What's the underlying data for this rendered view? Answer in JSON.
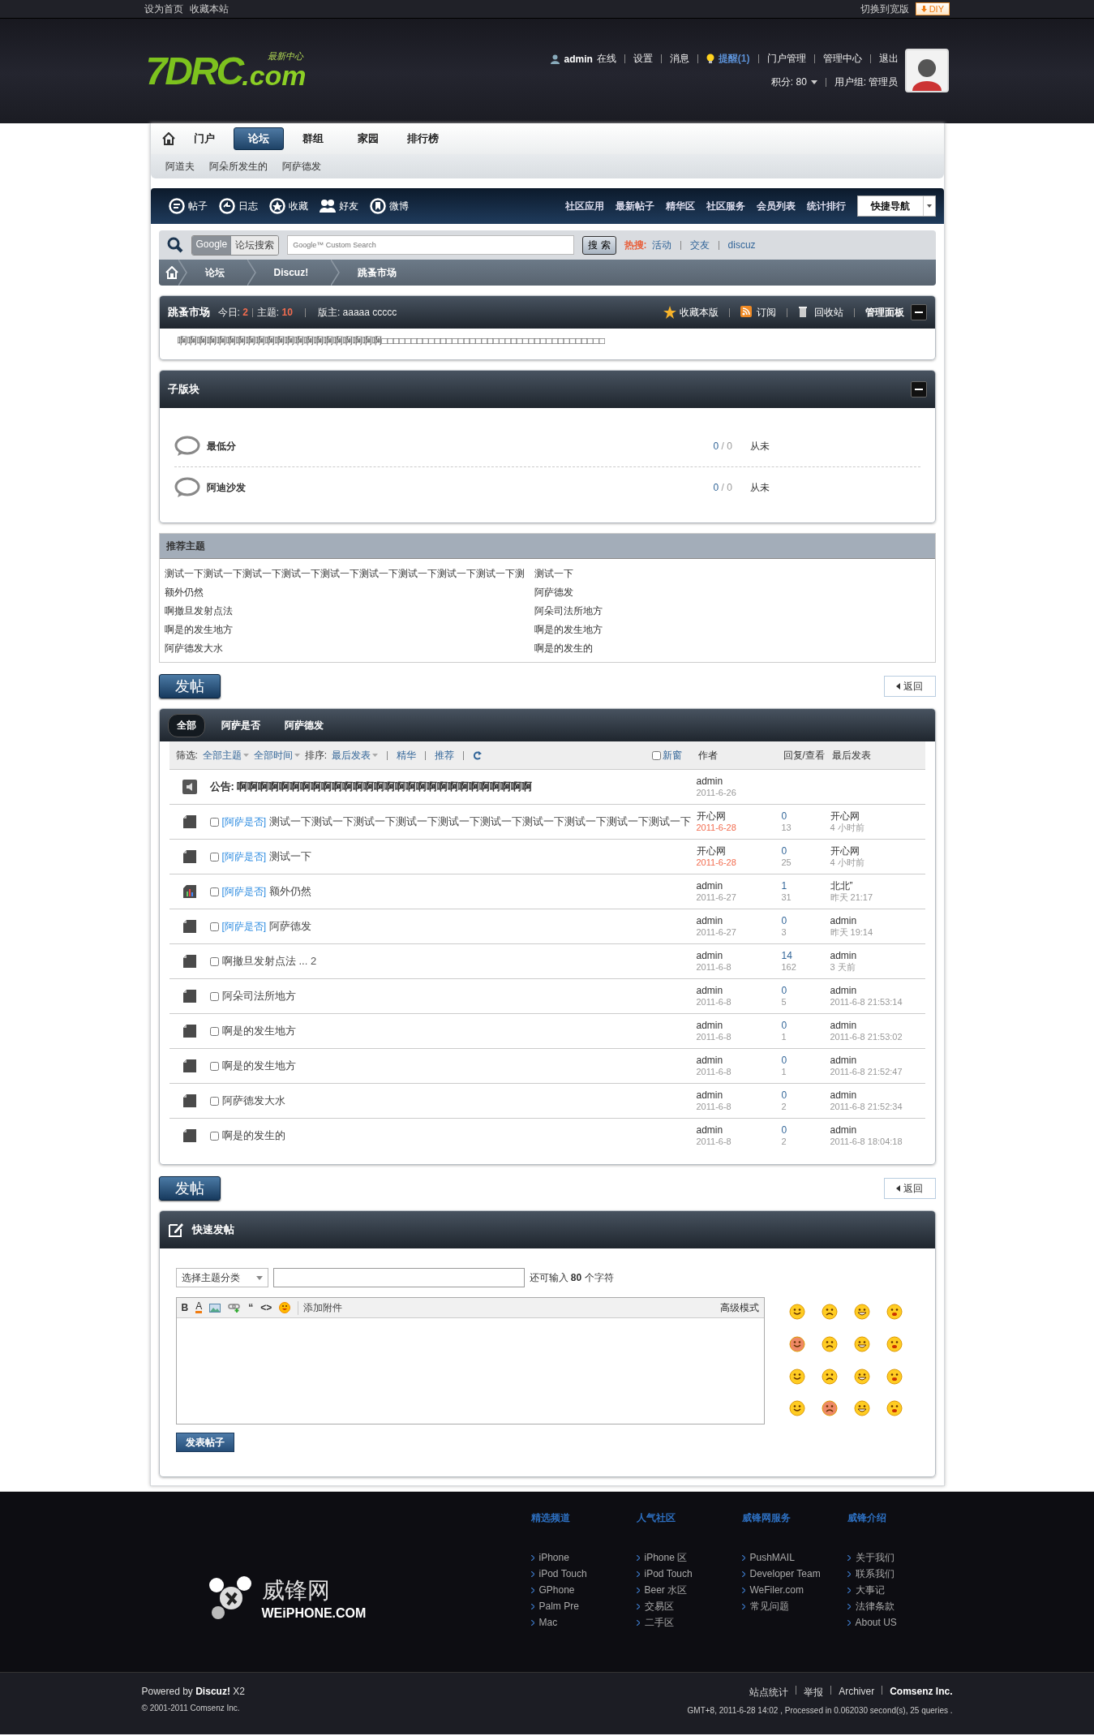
{
  "topbar": {
    "links": [
      "设为首页",
      "收藏本站"
    ],
    "switch": "切换到宽版",
    "diy": "DIY"
  },
  "header": {
    "logo": {
      "main": "7DRC",
      "suffix": ".com",
      "tagline": "最新中心"
    },
    "user": {
      "name": "admin",
      "status": "在线",
      "links": [
        "设置",
        "消息"
      ],
      "reminder": "提醒(1)",
      "links2": [
        "门户管理",
        "管理中心",
        "退出"
      ],
      "credits": "积分: 80",
      "group": "用户组: 管理员"
    }
  },
  "nav": {
    "items": [
      {
        "label": "门户",
        "selected": false
      },
      {
        "label": "论坛",
        "selected": true
      },
      {
        "label": "群组",
        "selected": false
      },
      {
        "label": "家园",
        "selected": false
      },
      {
        "label": "排行榜",
        "selected": false
      }
    ],
    "subnav": [
      "阿道夫",
      "阿朵所发生的",
      "阿萨德发"
    ]
  },
  "toolbar": {
    "items": [
      {
        "kind": "post",
        "label": "帖子"
      },
      {
        "kind": "blog",
        "label": "日志"
      },
      {
        "kind": "favorite",
        "label": "收藏"
      },
      {
        "kind": "friends",
        "label": "好友"
      },
      {
        "kind": "weibo",
        "label": "微博"
      }
    ],
    "links": [
      "社区应用",
      "最新帖子",
      "精华区",
      "社区服务",
      "会员列表",
      "统计排行"
    ],
    "quicknav": "快捷导航"
  },
  "search": {
    "scopes": [
      {
        "label": "Google",
        "selected": true
      },
      {
        "label": "论坛搜索",
        "selected": false
      }
    ],
    "placeholder": "Google™ Custom Search",
    "button": "搜 索",
    "hot_label": "热搜:",
    "hot": [
      "活动",
      "交友",
      "discuz"
    ]
  },
  "breadcrumb": [
    "论坛",
    "Discuz!",
    "跳蚤市场"
  ],
  "forum": {
    "name": "跳蚤市场",
    "today_label": "今日:",
    "today": "2",
    "topics_label": "主题:",
    "topics": "10",
    "mods_label": "版主:",
    "mods": [
      "aaaaa",
      "ccccc"
    ],
    "actions": [
      {
        "kind": "star",
        "label": "收藏本版"
      },
      {
        "kind": "rss",
        "label": "订阅"
      },
      {
        "kind": "trash",
        "label": "回收站"
      }
    ],
    "admin": "管理面板",
    "rules": "啊啊啊啊啊啊啊啊啊啊啊啊啊啊啊啊啊啊啊啊啊□□□□□□□□□□□□□□□□□□□□□□□□□□□□□□□□□□□□□□"
  },
  "subforums": {
    "title": "子版块",
    "expanded": true,
    "items": [
      {
        "name": "最低分",
        "threads": "0",
        "divider": "/",
        "posts": "0",
        "last": "从未"
      },
      {
        "name": "阿迪沙发",
        "threads": "0",
        "divider": "/",
        "posts": "0",
        "last": "从未"
      }
    ]
  },
  "recommended": {
    "title": "推荐主题",
    "items": [
      "测试一下测试一下测试一下测试一下测试一下测试一下测试一下测试一下测试一下测",
      "测试一下",
      "额外仍然",
      "阿萨德发",
      "啊撤旦发射点法",
      "阿朵司法所地方",
      "啊是的发生地方",
      "啊是的发生地方",
      "阿萨德发大水",
      "啊是的发生的"
    ]
  },
  "action_bars": [
    {
      "post_button": "发帖",
      "back_button": "返回"
    },
    {
      "post_button": "发帖",
      "back_button": "返回"
    }
  ],
  "threadlist": {
    "tabs": [
      {
        "label": "全部",
        "selected": true
      },
      {
        "label": "阿萨是否",
        "selected": false
      },
      {
        "label": "阿萨德发",
        "selected": false
      }
    ],
    "filter_label": "筛选:",
    "filters": [
      "全部主题",
      "全部时间"
    ],
    "sort_label": "排序:",
    "sort": "最后发表",
    "links": [
      "精华",
      "推荐"
    ],
    "new_window": {
      "label": "新窗",
      "checked": false
    },
    "columns": [
      "作者",
      "回复/查看",
      "最后发表"
    ],
    "announcement": {
      "label": "公告:",
      "title": "啊啊啊啊啊啊啊啊啊啊啊啊啊啊啊啊啊啊啊啊啊啊啊啊啊啊啊啊",
      "author": "admin",
      "date": "2011-6-26"
    },
    "threads": [
      {
        "kind": "normal",
        "checked": false,
        "tag": "[阿萨是否]",
        "title": "测试一下测试一下测试一下测试一下测试一下测试一下测试一下测试一下测试一下测试一下",
        "author": "开心网",
        "date": "2011-6-28",
        "new": true,
        "replies": "0",
        "views": "13",
        "last_author": "开心网",
        "last_time": "4 小时前"
      },
      {
        "kind": "normal",
        "checked": false,
        "tag": "[阿萨是否]",
        "title": "测试一下",
        "author": "开心网",
        "date": "2011-6-28",
        "new": true,
        "replies": "0",
        "views": "25",
        "last_author": "开心网",
        "last_time": "4 小时前"
      },
      {
        "kind": "poll",
        "checked": false,
        "tag": "[阿萨是否]",
        "title": "额外仍然",
        "author": "admin",
        "date": "2011-6-27",
        "new": false,
        "replies": "1",
        "views": "31",
        "last_author": "北北”",
        "last_time": "昨天 21:17"
      },
      {
        "kind": "normal",
        "checked": false,
        "tag": "[阿萨是否]",
        "title": "阿萨德发",
        "author": "admin",
        "date": "2011-6-27",
        "new": false,
        "replies": "0",
        "views": "3",
        "last_author": "admin",
        "last_time": "昨天 19:14"
      },
      {
        "kind": "normal",
        "checked": false,
        "title": "啊撤旦发射点法",
        "pages": "... 2",
        "author": "admin",
        "date": "2011-6-8",
        "new": false,
        "replies": "14",
        "views": "162",
        "last_author": "admin",
        "last_time": "3 天前"
      },
      {
        "kind": "normal",
        "checked": false,
        "title": "阿朵司法所地方",
        "author": "admin",
        "date": "2011-6-8",
        "new": false,
        "replies": "0",
        "views": "5",
        "last_author": "admin",
        "last_time": "2011-6-8 21:53:14"
      },
      {
        "kind": "normal",
        "checked": false,
        "title": "啊是的发生地方",
        "author": "admin",
        "date": "2011-6-8",
        "new": false,
        "replies": "0",
        "views": "1",
        "last_author": "admin",
        "last_time": "2011-6-8 21:53:02"
      },
      {
        "kind": "normal",
        "checked": false,
        "title": "啊是的发生地方",
        "author": "admin",
        "date": "2011-6-8",
        "new": false,
        "replies": "0",
        "views": "1",
        "last_author": "admin",
        "last_time": "2011-6-8 21:52:47"
      },
      {
        "kind": "normal",
        "checked": false,
        "title": "阿萨德发大水",
        "author": "admin",
        "date": "2011-6-8",
        "new": false,
        "replies": "0",
        "views": "2",
        "last_author": "admin",
        "last_time": "2011-6-8 21:52:34"
      },
      {
        "kind": "normal",
        "checked": false,
        "title": "啊是的发生的",
        "author": "admin",
        "date": "2011-6-8",
        "new": false,
        "replies": "0",
        "views": "2",
        "last_author": "admin",
        "last_time": "2011-6-8 18:04:18"
      }
    ]
  },
  "quickpost": {
    "title": "快速发帖",
    "category": "选择主题分类",
    "remaining_label": "还可输入",
    "remaining": "80",
    "remaining_unit": "个字符",
    "tools": [
      {
        "kind": "bold",
        "label": "B"
      },
      {
        "kind": "color",
        "label": "A"
      },
      {
        "kind": "image"
      },
      {
        "kind": "link"
      },
      {
        "kind": "quote",
        "label": "“"
      },
      {
        "kind": "code",
        "label": "<>"
      },
      {
        "kind": "smiley"
      }
    ],
    "attach": "添加附件",
    "advanced": "高级模式",
    "submit": "发表帖子"
  },
  "footer": {
    "brand": {
      "name": "威锋网",
      "domain": "WEiPHONE.COM"
    },
    "columns": [
      {
        "title": "精选频道",
        "links": [
          "iPhone",
          "iPod Touch",
          "GPhone",
          "Palm Pre",
          "Mac"
        ]
      },
      {
        "title": "人气社区",
        "links": [
          "iPhone 区",
          "iPod Touch",
          "Beer 水区",
          "交易区",
          "二手区"
        ]
      },
      {
        "title": "威锋网服务",
        "links": [
          "PushMAIL",
          "Developer Team",
          "WeFiler.com",
          "常见问题"
        ]
      },
      {
        "title": "威锋介绍",
        "links": [
          "关于我们",
          "联系我们",
          "大事记",
          "法律条款",
          "About US"
        ]
      }
    ],
    "powered": "Powered by **Discuz!** X2",
    "copyright": "© 2001-2011 Comsenz Inc.",
    "links": [
      "站点统计",
      "举报",
      "Archiver",
      "Comsenz Inc."
    ],
    "info": "GMT+8, 2011-6-28 14:02 , Processed in 0.062030 second(s), 25 queries ."
  }
}
